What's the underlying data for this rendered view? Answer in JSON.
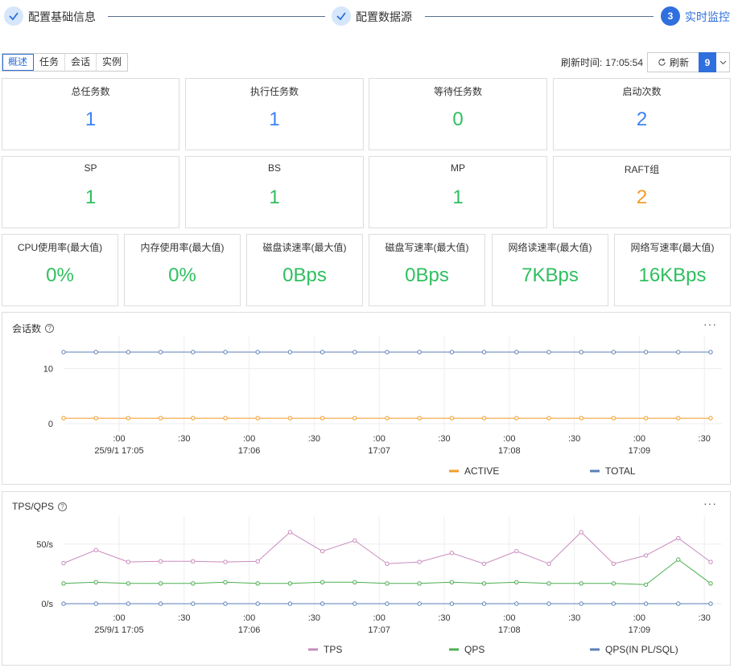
{
  "steps": [
    {
      "label": "配置基础信息",
      "state": "done"
    },
    {
      "label": "配置数据源",
      "state": "done"
    },
    {
      "label": "实时监控",
      "state": "active",
      "number": "3"
    }
  ],
  "tabs": [
    "概述",
    "任务",
    "会话",
    "实例"
  ],
  "refresh": {
    "time_label": "刷新时间:",
    "time": "17:05:54",
    "button": "刷新",
    "count": "9"
  },
  "cards_row1": [
    {
      "title": "总任务数",
      "value": "1",
      "color": "#3b82f6"
    },
    {
      "title": "执行任务数",
      "value": "1",
      "color": "#3b82f6"
    },
    {
      "title": "等待任务数",
      "value": "0",
      "color": "#2fbf5f"
    },
    {
      "title": "启动次数",
      "value": "2",
      "color": "#3b82f6"
    }
  ],
  "cards_row2": [
    {
      "title": "SP",
      "value": "1",
      "color": "#2fbf5f"
    },
    {
      "title": "BS",
      "value": "1",
      "color": "#2fbf5f"
    },
    {
      "title": "MP",
      "value": "1",
      "color": "#2fbf5f"
    },
    {
      "title": "RAFT组",
      "value": "2",
      "color": "#f39c28"
    }
  ],
  "cards_row3": [
    {
      "title": "CPU使用率(最大值)",
      "value": "0%"
    },
    {
      "title": "内存使用率(最大值)",
      "value": "0%"
    },
    {
      "title": "磁盘读速率(最大值)",
      "value": "0Bps"
    },
    {
      "title": "磁盘写速率(最大值)",
      "value": "0Bps"
    },
    {
      "title": "网络读速率(最大值)",
      "value": "7KBps"
    },
    {
      "title": "网络写速率(最大值)",
      "value": "16KBps"
    }
  ],
  "chart_data": [
    {
      "type": "line",
      "title": "会话数",
      "x_ticks": [
        ":00",
        ":30",
        ":00",
        ":30",
        ":00",
        ":30",
        ":00",
        ":30",
        ":00",
        ":30"
      ],
      "x_minor": [
        "25/9/1 17:05",
        "17:06",
        "17:07",
        "17:08",
        "17:09"
      ],
      "y_ticks": [
        "0",
        "10"
      ],
      "ylim": [
        0,
        13
      ],
      "legend": "bottom",
      "series": [
        {
          "name": "ACTIVE",
          "color": "#f39c28",
          "values": [
            1,
            1,
            1,
            1,
            1,
            1,
            1,
            1,
            1,
            1,
            1,
            1,
            1,
            1,
            1,
            1,
            1,
            1,
            1,
            1,
            1
          ]
        },
        {
          "name": "TOTAL",
          "color": "#5b7fb5",
          "values": [
            13,
            13,
            13,
            13,
            13,
            13,
            13,
            13,
            13,
            13,
            13,
            13,
            13,
            13,
            13,
            13,
            13,
            13,
            13,
            13,
            13
          ]
        }
      ]
    },
    {
      "type": "line",
      "title": "TPS/QPS",
      "x_ticks": [
        ":00",
        ":30",
        ":00",
        ":30",
        ":00",
        ":30",
        ":00",
        ":30",
        ":00",
        ":30"
      ],
      "x_minor": [
        "25/9/1 17:05",
        "17:06",
        "17:07",
        "17:08",
        "17:09"
      ],
      "y_ticks": [
        "0/s",
        "50/s"
      ],
      "ylim": [
        0,
        60
      ],
      "legend": "bottom",
      "series": [
        {
          "name": "TPS",
          "color": "#c98bbd",
          "values": [
            34,
            45,
            35,
            35.5,
            35.5,
            35,
            35.5,
            60,
            44,
            53,
            33.5,
            35,
            42.5,
            33.5,
            44,
            33.5,
            60,
            33.5,
            40.5,
            55,
            35
          ]
        },
        {
          "name": "QPS",
          "color": "#4caf50",
          "values": [
            17,
            18,
            17,
            17,
            17,
            18,
            17,
            17,
            18,
            18,
            17,
            17,
            18,
            17,
            18,
            17,
            17,
            17,
            16,
            37,
            17
          ]
        },
        {
          "name": "QPS(IN PL/SQL)",
          "color": "#5b7fb5",
          "values": [
            0,
            0,
            0,
            0,
            0,
            0,
            0,
            0,
            0,
            0,
            0,
            0,
            0,
            0,
            0,
            0,
            0,
            0,
            0,
            0,
            0
          ]
        }
      ]
    }
  ]
}
